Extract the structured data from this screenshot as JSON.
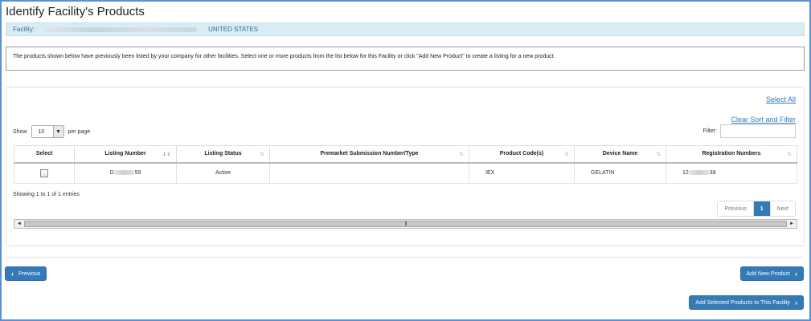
{
  "page": {
    "title": "Identify Facility's Products"
  },
  "facility": {
    "label": "Facility:",
    "country": "UNITED STATES"
  },
  "info": {
    "message": "The products shown below have previously been listed by your company for other facilities. Select one or more products from the list below for this Facility or click \"Add New Product\" to create a listing for a new product."
  },
  "table_controls": {
    "select_all": "Select All",
    "clear_sort_filter": "Clear Sort and Filter",
    "show_label": "Show",
    "page_size": "10",
    "per_page_label": "per page",
    "filter_label": "Filter:"
  },
  "table": {
    "columns": [
      "Select",
      "Listing Number",
      "Listing Status",
      "Premarket Submission Number/Type",
      "Product Code(s)",
      "Device Name",
      "Registration Numbers"
    ],
    "rows": [
      {
        "listing_prefix": "D",
        "listing_suffix": "59",
        "status": "Active",
        "premarket": "",
        "product_code": "IEX",
        "device_name": "GELATIN",
        "reg_prefix": "12",
        "reg_suffix": "38"
      }
    ]
  },
  "footer_info": {
    "showing": "Showing 1 to 1 of 1 entries"
  },
  "pagination": {
    "previous": "Previous",
    "current": "1",
    "next": "Next"
  },
  "scrollbar": {
    "left": "◄",
    "grip": "|||",
    "right": "►"
  },
  "buttons": {
    "previous": "Previous",
    "add_new_product": "Add New Product",
    "add_selected": "Add Selected Products to This Facility"
  },
  "icons": {
    "sort_active": "sort-desc-icon",
    "sort_default": "sort-both-icon",
    "chevron_left": "chevron-left-icon",
    "chevron_right": "chevron-right-icon"
  },
  "colors": {
    "primary": "#337ab7",
    "facility_bg": "#d9ecf5",
    "frame_border": "#5b8fd6"
  }
}
